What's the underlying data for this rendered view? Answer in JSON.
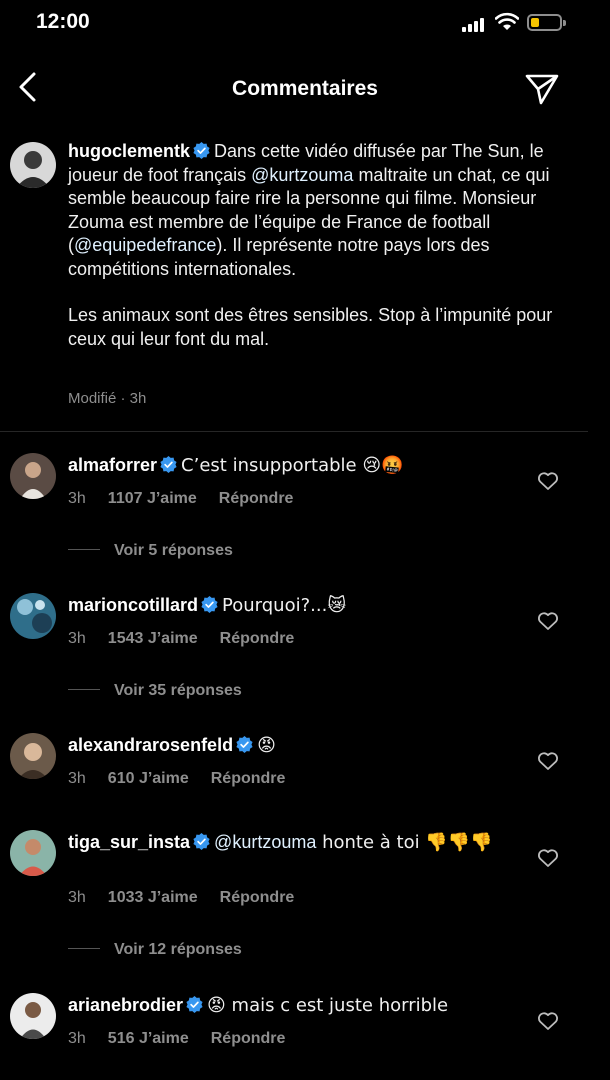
{
  "status_bar": {
    "time": "12:00"
  },
  "header": {
    "title": "Commentaires"
  },
  "post": {
    "username": "hugoclementk",
    "caption_part1": "Dans cette vidéo diffusée par The Sun, le joueur de foot français ",
    "mention1": "@kurtzouma",
    "caption_part2": " maltraite un chat, ce qui semble beaucoup faire rire la personne qui filme. Monsieur Zouma est membre de l’équipe de France de football (",
    "mention2": "@equipedefrance",
    "caption_part3": "). Il représente notre pays lors des compétitions internationales.",
    "caption_paragraph2": "Les animaux sont des êtres sensibles. Stop à l’impunité pour ceux qui leur font du mal.",
    "meta": "Modifié · 3h"
  },
  "comments": [
    {
      "username": "almaforrer",
      "text": "C’est insupportable 😢🤬",
      "time": "3h",
      "likes": "1107 J’aime",
      "reply": "Répondre",
      "replies": "Voir 5 réponses"
    },
    {
      "username": "marioncotillard",
      "text": "Pourquoi?...😿",
      "time": "3h",
      "likes": "1543 J’aime",
      "reply": "Répondre",
      "replies": "Voir 35 réponses"
    },
    {
      "username": "alexandrarosenfeld",
      "text": "😡",
      "time": "3h",
      "likes": "610 J’aime",
      "reply": "Répondre"
    },
    {
      "username": "tiga_sur_insta",
      "mention": "@kurtzouma",
      "text": " honte à toi 👎👎👎",
      "time": "3h",
      "likes": "1033 J’aime",
      "reply": "Répondre",
      "replies": "Voir 12 réponses"
    },
    {
      "username": "arianebrodier",
      "text": "😡 mais c est juste horrible",
      "time": "3h",
      "likes": "516 J’aime",
      "reply": "Répondre"
    }
  ],
  "colors": {
    "background": "#000000",
    "verified": "#3897f0",
    "muted": "#8e8e8e",
    "battery": "#f5c400"
  },
  "icons": [
    "back-icon",
    "send-icon",
    "verified-icon",
    "heart-icon",
    "signal-icon",
    "wifi-icon",
    "battery-icon"
  ]
}
